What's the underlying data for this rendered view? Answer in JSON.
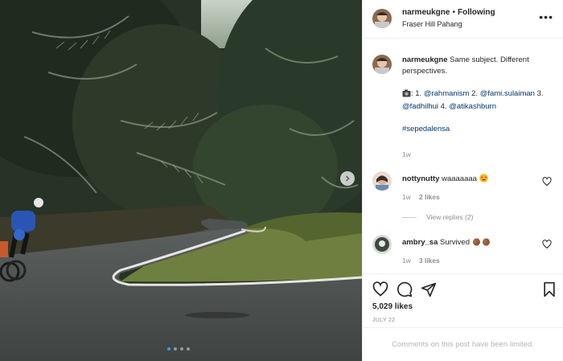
{
  "post": {
    "username": "narmeukgne",
    "separator": "•",
    "follow_status": "Following",
    "location": "Fraser Hill Pahang"
  },
  "caption": {
    "username": "narmeukgne",
    "text_1": "Same subject. Different perspectives.",
    "camera_icon": "camera-icon",
    "credit_prefix": ": 1. ",
    "credit_1": "@rahmanism",
    "credit_sep_2": " 2. ",
    "credit_2": "@fami.sulaiman",
    "credit_sep_3": " 3. ",
    "credit_3": "@fadhilhui",
    "credit_sep_4": " 4. ",
    "credit_4": "@atikashburn",
    "hashtag": "#sepedalensa",
    "time": "1w"
  },
  "comments": [
    {
      "username": "nottynutty",
      "text": "waaaaaaa",
      "emoji": "star-struck-emoji",
      "time": "1w",
      "likes": "2 likes",
      "replies": "View replies (2)"
    },
    {
      "username": "ambry_sa",
      "text": "Survived",
      "emoji": "clapping-hands-emoji",
      "time": "1w",
      "likes": "3 likes"
    }
  ],
  "actions": {
    "like_icon": "heart-icon",
    "comment_icon": "comment-icon",
    "share_icon": "share-icon",
    "save_icon": "bookmark-icon",
    "likes": "5,029 likes",
    "date": "JULY 22"
  },
  "footer": {
    "comments_limited": "Comments on this post have been limited."
  },
  "carousel": {
    "current": 1,
    "total": 4
  }
}
